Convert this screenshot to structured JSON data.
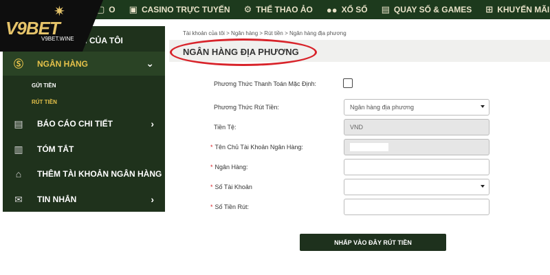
{
  "logo": {
    "brand": "V9BET",
    "site": "V9BET.WINE"
  },
  "topnav": [
    {
      "label": "O",
      "icon": "casino-card-icon"
    },
    {
      "label": "CASINO TRỰC TUYẾN",
      "icon": "casino-card-icon"
    },
    {
      "label": "THỂ THAO ẢO",
      "icon": "gamepad-icon"
    },
    {
      "label": "XỔ SỐ",
      "icon": "lottery-balls-icon"
    },
    {
      "label": "QUAY SỐ & GAMES",
      "icon": "slot-machine-icon"
    },
    {
      "label": "KHUYẾN MÃI",
      "icon": "gift-icon"
    }
  ],
  "sidebar": {
    "account_label": "N CỦA TÔI",
    "bank_label": "NGÂN HÀNG",
    "sub_deposit": "GỬI TIỀN",
    "sub_withdraw": "RÚT TIỀN",
    "report_label": "BÁO CÁO CHI TIẾT",
    "summary_label": "TÓM TẮT",
    "add_bank_label": "THÊM TÀI KHOẢN NGÂN HÀNG",
    "messages_label": "TIN NHẮN"
  },
  "breadcrumb": "Tài khoản của tôi > Ngân hàng > Rút tiền > Ngân hàng địa phương",
  "page_title": "NGÂN HÀNG ĐỊA PHƯƠNG",
  "form": {
    "default_payment_label": "Phương Thức Thanh Toán Mặc Định:",
    "withdraw_method_label": "Phương Thức Rút Tiền:",
    "withdraw_method_value": "Ngân hàng địa phương",
    "currency_label": "Tiền Tệ:",
    "currency_value": "VND",
    "account_holder_label": "Tên Chủ Tài Khoản Ngân Hàng:",
    "bank_label": "Ngân Hàng:",
    "account_number_label": "Số Tài Khoản",
    "amount_label": "Số Tiền Rút:",
    "required_mark": "*"
  },
  "submit_label": "NHẤP VÀO ĐÂY RÚT TIỀN"
}
